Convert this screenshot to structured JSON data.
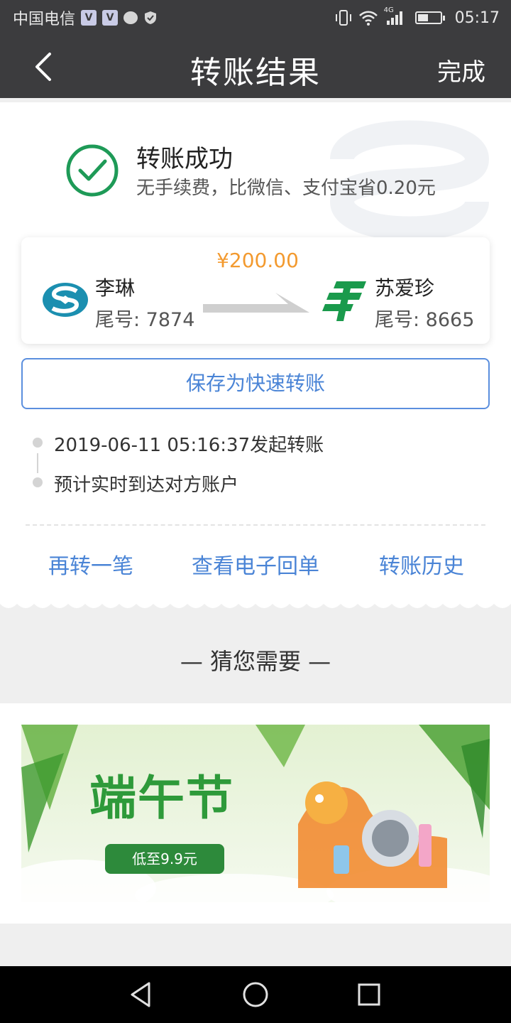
{
  "status_bar": {
    "carrier": "中国电信",
    "time": "05:17",
    "mini_icon": "V",
    "icons": [
      "vpn-icon",
      "vpn-icon",
      "chat-icon",
      "shield-icon",
      "vibrate-icon",
      "wifi-icon",
      "4g-signal-icon",
      "battery-icon"
    ],
    "signal_label": "4G"
  },
  "nav": {
    "title": "转账结果",
    "done_label": "完成"
  },
  "result": {
    "title": "转账成功",
    "subtitle": "无手续费，比微信、支付宝省0.20元",
    "success_color": "#1e9a57"
  },
  "transfer": {
    "amount": "¥200.00",
    "from": {
      "name": "李琳",
      "tail": "尾号: 7874",
      "bank_icon": "cmb-bank-icon"
    },
    "to": {
      "name": "苏爱珍",
      "tail": "尾号: 8665",
      "bank_icon": "postal-bank-icon"
    }
  },
  "save_button_label": "保存为快速转账",
  "timeline": [
    {
      "text": "2019-06-11 05:16:37发起转账"
    },
    {
      "text": "预计实时到达对方账户"
    }
  ],
  "actions": {
    "again": "再转一笔",
    "receipt": "查看电子回单",
    "history": "转账历史"
  },
  "recommend": {
    "title": "— 猜您需要 —",
    "banner": {
      "headline": "端午节",
      "promo": "低至9.9元"
    }
  },
  "colors": {
    "accent": "#4a84d6",
    "amount": "#f39a2f",
    "bar_bg": "#3c3c3e"
  }
}
